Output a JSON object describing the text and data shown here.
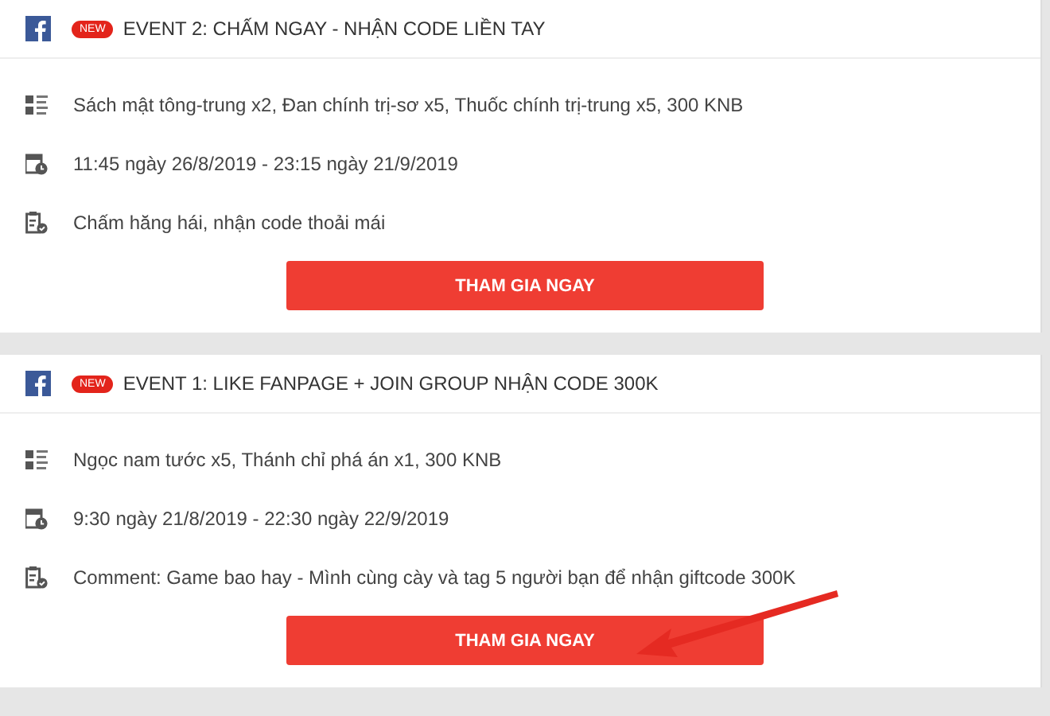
{
  "events": [
    {
      "badge": "NEW",
      "title": "EVENT 2: CHẤM NGAY - NHẬN CODE LIỀN TAY",
      "details": [
        {
          "kind": "rewards",
          "text": "Sách mật tông-trung x2, Đan chính trị-sơ x5, Thuốc chính trị-trung x5, 300 KNB"
        },
        {
          "kind": "time",
          "text": "11:45 ngày 26/8/2019 - 23:15 ngày 21/9/2019"
        },
        {
          "kind": "task",
          "text": "Chấm hăng hái, nhận code thoải mái"
        }
      ],
      "button": "THAM GIA NGAY",
      "pointed": false
    },
    {
      "badge": "NEW",
      "title": "EVENT 1: LIKE FANPAGE + JOIN GROUP NHẬN CODE 300K",
      "details": [
        {
          "kind": "rewards",
          "text": "Ngọc nam tước x5, Thánh chỉ phá án x1, 300 KNB"
        },
        {
          "kind": "time",
          "text": "9:30 ngày 21/8/2019 - 22:30 ngày 22/9/2019"
        },
        {
          "kind": "task",
          "text": "Comment: Game bao hay - Mình cùng cày và tag 5 người bạn để nhận giftcode 300K"
        }
      ],
      "button": "THAM GIA NGAY",
      "pointed": true
    }
  ]
}
